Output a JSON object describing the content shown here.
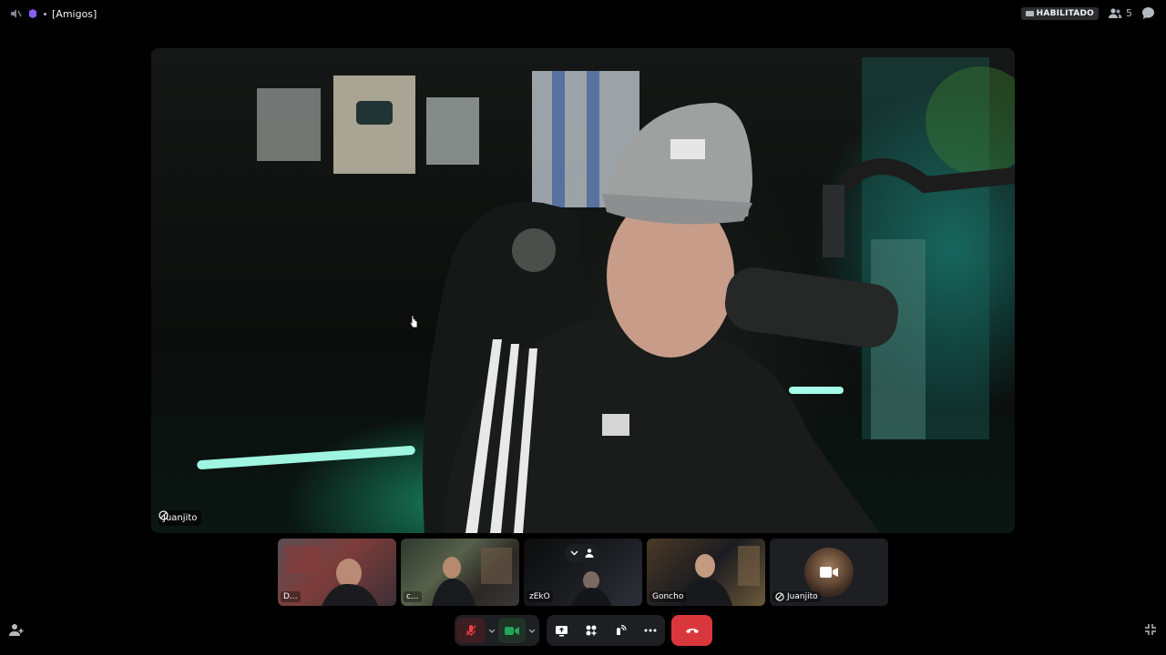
{
  "topbar": {
    "channel_name": "[Amigos]",
    "status_badge": "HABILITADO",
    "member_count": "5"
  },
  "main_stage": {
    "speaker_name": "Juanjito"
  },
  "participants": [
    {
      "name": "D..."
    },
    {
      "name": "c..."
    },
    {
      "name": "zEkO"
    },
    {
      "name": "Goncho"
    },
    {
      "name": "Juanjito"
    }
  ],
  "controls": {
    "icons": [
      "mic-muted-icon",
      "chevron-down-icon",
      "camera-icon",
      "chevron-down-icon",
      "screen-share-icon",
      "activities-icon",
      "soundboard-icon",
      "more-icon",
      "hangup-icon"
    ]
  },
  "colors": {
    "leave": "#da373c",
    "muted_bg": "#3b1d22",
    "camera_on": "#23a55a"
  }
}
